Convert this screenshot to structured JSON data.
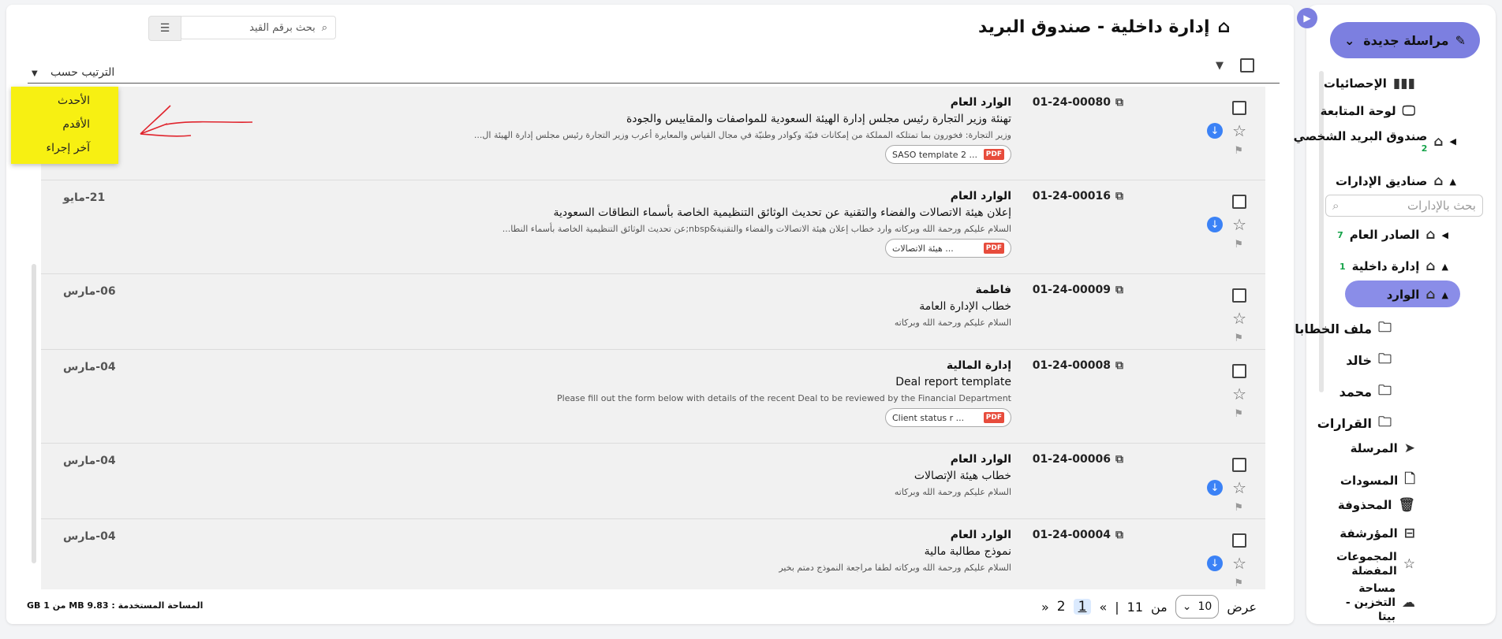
{
  "sidebar": {
    "new_message": "مراسلة جديدة",
    "items": [
      {
        "label": "الإحصائيات"
      },
      {
        "label": "لوحة المتابعة"
      },
      {
        "label": "صندوق البريد الشخصي",
        "badge": "2"
      },
      {
        "label": "صناديق الإدارات"
      },
      {
        "label": "الصادر العام",
        "badge": "7"
      },
      {
        "label": "إدارة داخلية",
        "badge": "1"
      },
      {
        "label": "الوارد"
      },
      {
        "label": "ملف الخطابات"
      },
      {
        "label": "خالد"
      },
      {
        "label": "محمد"
      },
      {
        "label": "القرارات"
      },
      {
        "label": "المرسلة"
      },
      {
        "label": "المسودات"
      },
      {
        "label": "المحذوفة"
      },
      {
        "label": "المؤرشفة"
      },
      {
        "label": "المجموعات المفضلة"
      },
      {
        "label": "مساحة التخزين - بيتا"
      }
    ],
    "unit_search_placeholder": "بحث بالإدارات"
  },
  "header": {
    "title": "إدارة داخلية - صندوق البريد",
    "search_placeholder": "بحث برقم القيد"
  },
  "sort": {
    "label": "الترتيب حسب",
    "options": [
      "الأحدث",
      "الأقدم",
      "آخر إجراء"
    ]
  },
  "rows": [
    {
      "ref": "01-24-00080",
      "sender": "الوارد العام",
      "subject": "تهنئة وزير التجارة رئيس مجلس إدارة الهيئة السعودية للمواصفات والمقاييس والجودة",
      "snippet": "وزير التجارة: فخورون بما تمتلكه المملكة من إمكانات فنيّة وكوادر وطنيّة في مجال القياس والمعايرة أعرب وزير التجارة رئيس مجلس إدارة الهيئة ال...",
      "attachment": "SASO template 2 ...",
      "date": ""
    },
    {
      "ref": "01-24-00016",
      "sender": "الوارد العام",
      "subject": "إعلان هيئة الاتصالات والفضاء والتقنية عن تحديث الوثائق التنظيمية الخاصة بأسماء النطاقات السعودية",
      "snippet": "السلام عليكم ورحمة الله وبركاته وارد خطاب إعلان هيئة الاتصالات والفضاء والتقنية&nbsp;عن تحديث الوثائق التنظيمية الخاصة بأسماء النطا...",
      "attachment": "هيئة الاتصالات ...",
      "date": "21-مايو"
    },
    {
      "ref": "01-24-00009",
      "sender": "فاطمة",
      "subject": "خطاب الإدارة العامة",
      "snippet": "السلام عليكم ورحمة الله وبركاته",
      "attachment": "",
      "date": "06-مارس"
    },
    {
      "ref": "01-24-00008",
      "sender": "إدارة المالية",
      "subject": "Deal report template",
      "snippet": "Please fill out the form below with details of the recent Deal to be reviewed by the Financial Department",
      "attachment": "Client status r ...",
      "date": "04-مارس"
    },
    {
      "ref": "01-24-00006",
      "sender": "الوارد العام",
      "subject": "خطاب هيئة الإتصالات",
      "snippet": "السلام عليكم ورحمة الله وبركاته",
      "attachment": "",
      "date": "04-مارس"
    },
    {
      "ref": "01-24-00004",
      "sender": "الوارد العام",
      "subject": "نموذج مطالبة مالية",
      "snippet": "السلام عليكم ورحمة الله وبركاته لطفا مراجعة النموذج دمتم بخير",
      "attachment": "",
      "date": "04-مارس"
    }
  ],
  "pager": {
    "show_label": "عرض",
    "per_page": "10",
    "of_label": "من",
    "total": "11",
    "sep": "|",
    "first": "«",
    "page1": "1",
    "page2": "2",
    "last": "»"
  },
  "storage": "المساحة المستخدمة : MB 9.83 من GB 1"
}
